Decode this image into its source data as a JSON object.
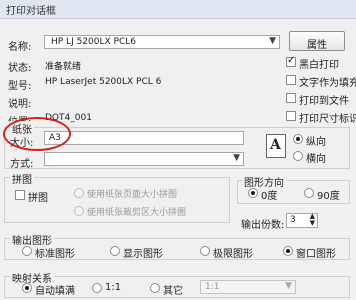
{
  "window": {
    "title": "打印对话框"
  },
  "printer": {
    "name_label": "名称:",
    "name_value": "HP LJ 5200LX PCL6",
    "properties_label": "属性",
    "status_label": "状态:",
    "status_value": "准备就绪",
    "model_label": "型号:",
    "model_value": "HP LaserJet 5200LX PCL 6",
    "desc_label": "说明:",
    "desc_value": "",
    "location_label": "位置:",
    "location_value": "DOT4_001",
    "options": [
      {
        "label": "黑白打印",
        "checked": true
      },
      {
        "label": "文字作为填充",
        "checked": false
      },
      {
        "label": "打印到文件",
        "checked": false
      },
      {
        "label": "打印尺寸标识",
        "checked": false
      }
    ]
  },
  "paper": {
    "group_label": "纸张",
    "size_label": "大小:",
    "size_value": "A3",
    "source_label": "方式:",
    "source_value": "",
    "orientation_portrait": "纵向",
    "orientation_landscape": "横向",
    "orientation_selected": "portrait",
    "orientation_icon": "A"
  },
  "tile": {
    "group_label": "拼图",
    "checkbox_label": "拼图",
    "option1": "使用纸张页面大小拼图",
    "option2": "使用纸张裁剪区大小拼图"
  },
  "figure_direction": {
    "group_label": "图形方向",
    "option_0": "0度",
    "option_90": "90度",
    "selected": "0"
  },
  "copies": {
    "label": "输出份数:",
    "value": "3"
  },
  "output": {
    "group_label": "输出图形",
    "options": [
      "标准图形",
      "显示图形",
      "极限图形",
      "窗口图形"
    ],
    "selected": 3
  },
  "mapping": {
    "group_label": "映射关系",
    "options": [
      "自动填满",
      "1:1",
      "其它"
    ],
    "selected": 0,
    "ratio_value": "1:1"
  },
  "colors": {
    "highlight": "#d42020"
  }
}
